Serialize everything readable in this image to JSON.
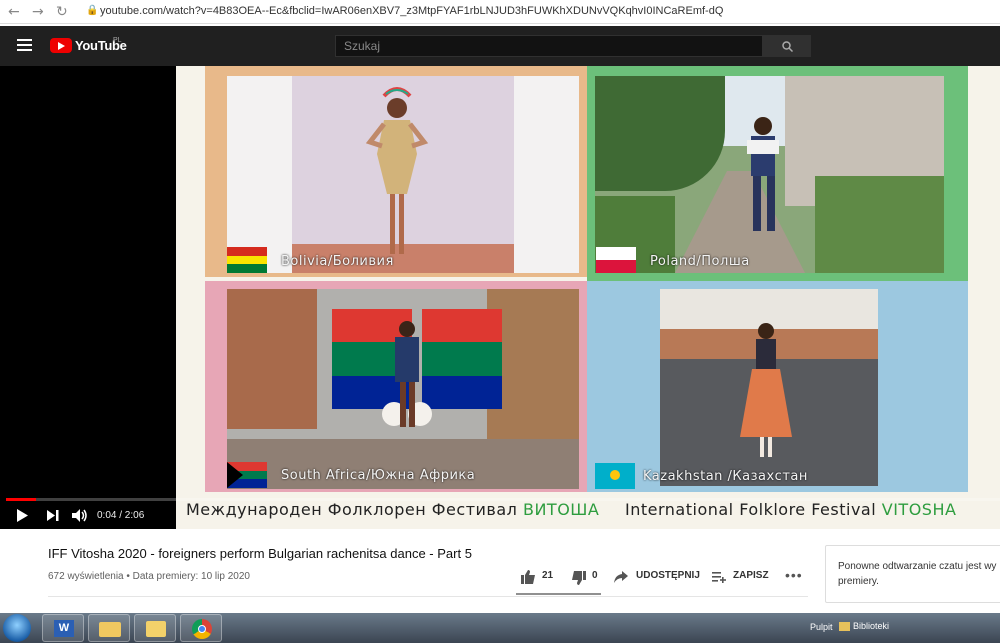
{
  "browser": {
    "url": "youtube.com/watch?v=4B83OEA--Ec&fbclid=IwAR06enXBV7_z3MtpFYAF1rbLNJUD3hFUWKhXDUNvVQKqhvI0INCaREmf-dQ"
  },
  "youtube": {
    "logo_text": "YouTube",
    "country_code": "PL",
    "search_placeholder": "Szukaj"
  },
  "video": {
    "panels": [
      {
        "caption": "Bolivia/Боливия",
        "border": "#e8b98a"
      },
      {
        "caption": "Poland/Полша",
        "border": "#6cc07a"
      },
      {
        "caption": "South Africa/Южна Африка",
        "border": "#e7a6b6"
      },
      {
        "caption": "Kazakhstan /Казахстан",
        "border": "#9cc8e0"
      }
    ],
    "banner_bg_text": "Международен Фолклорен Фестивал",
    "banner_bg_highlight": "ВИТОША",
    "banner_en_text": "International Folklore Festival",
    "banner_en_highlight": "VITOSHA",
    "progress_fraction": 0.03,
    "time_display": "0:04 / 2:06"
  },
  "meta": {
    "title": "IFF Vitosha 2020 - foreigners perform Bulgarian rachenitsa dance - Part 5",
    "views": "672 wyświetlenia • Data premiery: 10 lip 2020",
    "likes": "21",
    "dislikes": "0",
    "share_label": "UDOSTĘPNIJ",
    "save_label": "ZAPISZ"
  },
  "chat": {
    "message": "Ponowne odtwarzanie czatu jest wy premiery."
  },
  "taskbar": {
    "desktop_label": "Pulpit",
    "libraries_label": "Biblioteki"
  },
  "colors": {
    "youtube_red": "#ff0000",
    "banner_green": "#2e9d3f"
  }
}
